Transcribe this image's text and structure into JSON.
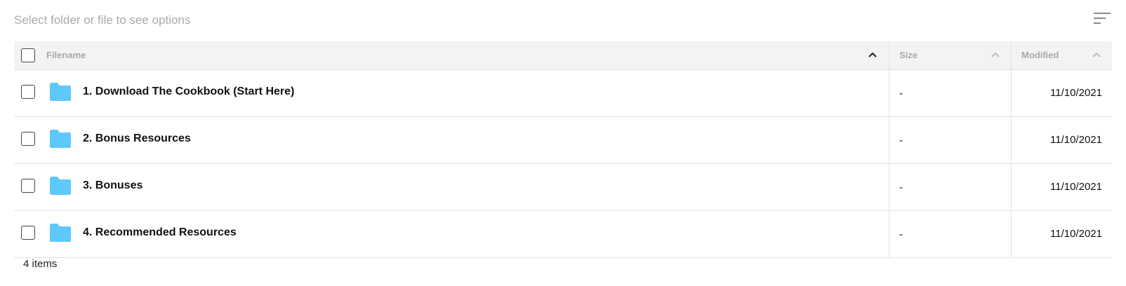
{
  "toolbar": {
    "hint": "Select folder or file to see options",
    "sort_menu_icon": "sort-lines-icon"
  },
  "table": {
    "columns": {
      "filename": "Filename",
      "size": "Size",
      "modified": "Modified"
    },
    "sort_icon": "chevron-up-icon",
    "active_sort_column": "filename",
    "folder_color": "#5fc8fb",
    "rows": [
      {
        "name": "1. Download The Cookbook (Start Here)",
        "type": "folder",
        "size": "-",
        "modified": "11/10/2021"
      },
      {
        "name": "2. Bonus Resources",
        "type": "folder",
        "size": "-",
        "modified": "11/10/2021"
      },
      {
        "name": "3. Bonuses",
        "type": "folder",
        "size": "-",
        "modified": "11/10/2021"
      },
      {
        "name": "4. Recommended Resources",
        "type": "folder",
        "size": "-",
        "modified": "11/10/2021"
      }
    ]
  },
  "footer": {
    "count": "4 items"
  }
}
